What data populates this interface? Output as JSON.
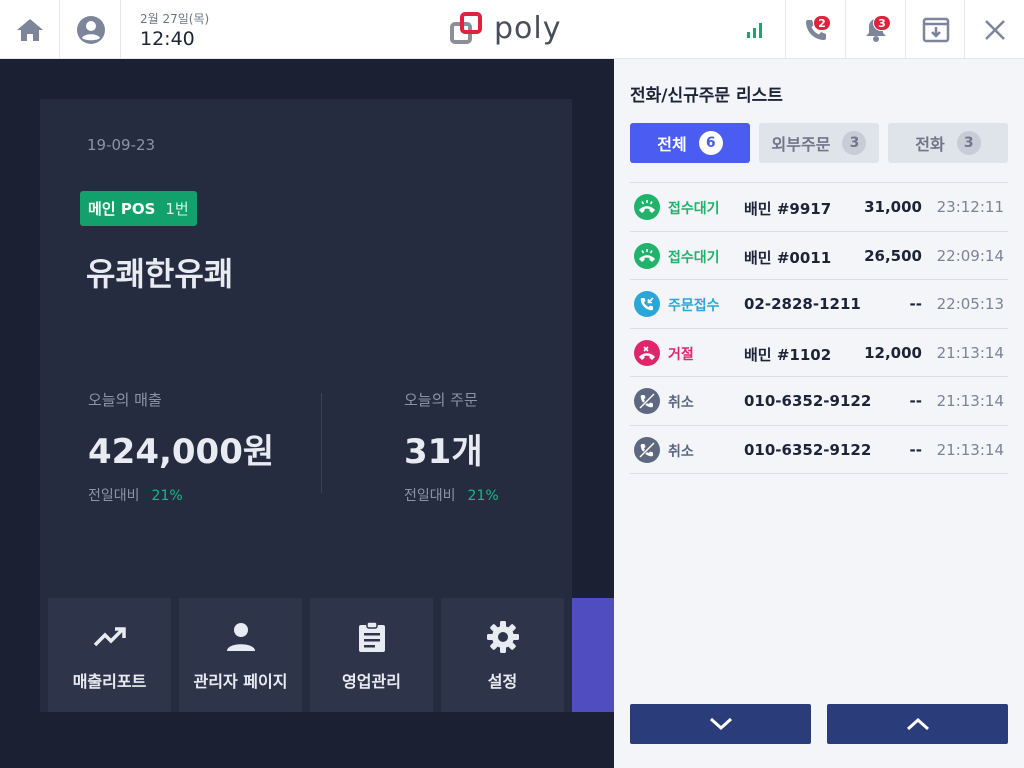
{
  "header": {
    "date": "2월 27일(목)",
    "time": "12:40",
    "logo_text": "poly",
    "call_badge": "2",
    "notification_badge": "3",
    "icons": [
      "home-icon",
      "account-icon",
      "signal-icon",
      "phone-icon",
      "bell-icon",
      "download-tray-icon",
      "close-icon"
    ]
  },
  "dashboard": {
    "date": "19-09-23",
    "pos_label": "메인 POS",
    "pos_number": "1번",
    "store_name": "유쾌한유쾌",
    "sales": {
      "label": "오늘의 매출",
      "value": "424,000원",
      "compare_label": "전일대비",
      "compare_pct": "21%"
    },
    "orders": {
      "label": "오늘의 주문",
      "value": "31개",
      "compare_label": "전일대비",
      "compare_pct": "21%"
    },
    "menu": [
      {
        "label": "매출리포트",
        "icon": "trending-up-icon"
      },
      {
        "label": "관리자 페이지",
        "icon": "person-icon"
      },
      {
        "label": "영업관리",
        "icon": "clipboard-icon"
      },
      {
        "label": "설정",
        "icon": "gear-icon"
      }
    ]
  },
  "panel": {
    "title": "전화/신규주문 리스트",
    "tabs": [
      {
        "label": "전체",
        "count": "6",
        "active": true
      },
      {
        "label": "외부주문",
        "count": "3",
        "active": false
      },
      {
        "label": "전화",
        "count": "3",
        "active": false
      }
    ],
    "orders": [
      {
        "status": "접수대기",
        "who": "배민  #9917",
        "amount": "31,000",
        "time": "23:12:11",
        "kind": "waiting"
      },
      {
        "status": "접수대기",
        "who": "배민 #0011",
        "amount": "26,500",
        "time": "22:09:14",
        "kind": "waiting"
      },
      {
        "status": "주문접수",
        "who": "02-2828-1211",
        "amount": "--",
        "time": "22:05:13",
        "kind": "accepted"
      },
      {
        "status": "거절",
        "who": "배민 #1102",
        "amount": "12,000",
        "time": "21:13:14",
        "kind": "rejected"
      },
      {
        "status": "취소",
        "who": "010-6352-9122",
        "amount": "--",
        "time": "21:13:14",
        "kind": "cancelled"
      },
      {
        "status": "취소",
        "who": "010-6352-9122",
        "amount": "--",
        "time": "21:13:14",
        "kind": "cancelled"
      }
    ]
  },
  "colors": {
    "accent": "#4a5cf2",
    "waiting": "#1fb36b",
    "accepted": "#2aa7d8",
    "rejected": "#e0266b",
    "cancelled": "#5e6880",
    "nav_button": "#2a3d7a"
  }
}
